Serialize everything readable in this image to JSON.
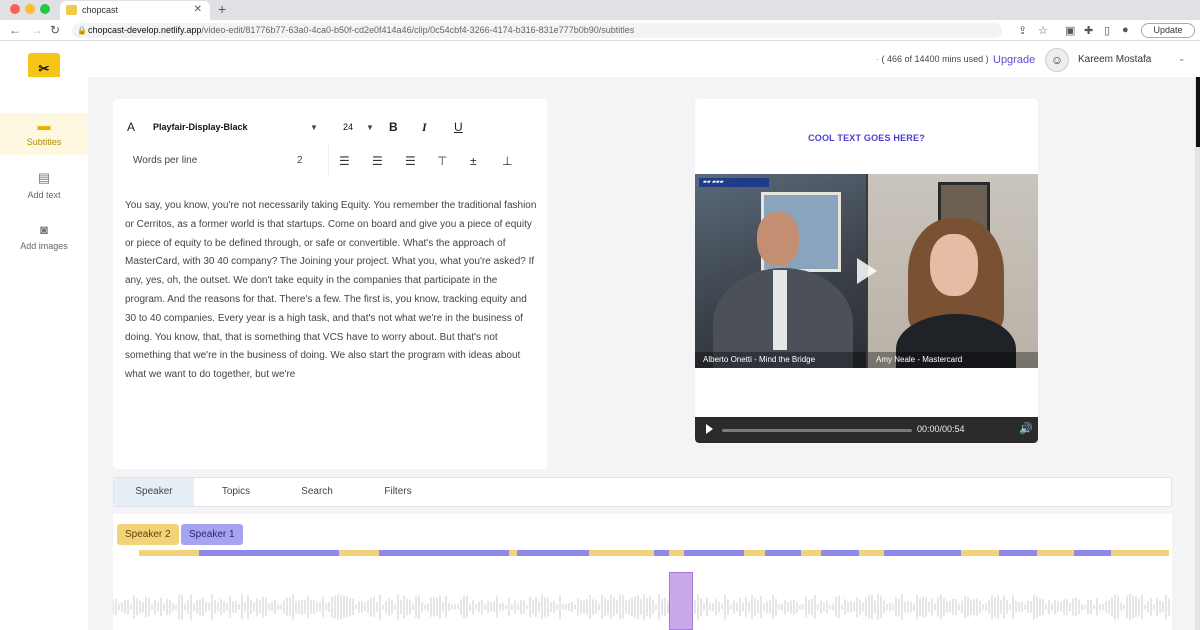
{
  "browser": {
    "tab_title": "chopcast",
    "url_host": "chopcast-develop.netlify.app",
    "url_path": "/video-edit/81776b77-63a0-4ca0-b50f-cd2e0f414a46/clip/0c54cbf4-3266-4174-b316-831e777b0b90/subtitles",
    "update_label": "Update"
  },
  "header": {
    "usage": "( 466 of 14400 mins used )",
    "upgrade_label": "Upgrade",
    "user_name": "Kareem Mostafa"
  },
  "sidebar": {
    "items": [
      {
        "label": "Subtitles",
        "icon": "subtitles-icon"
      },
      {
        "label": "Add text",
        "icon": "text-icon"
      },
      {
        "label": "Add images",
        "icon": "camera-icon"
      }
    ]
  },
  "toolbar": {
    "font_name": "Playfair-Display-Black",
    "font_size": "24",
    "words_per_line_label": "Words per line",
    "words_per_line_value": "2"
  },
  "transcript": "You say, you know, you're not necessarily taking Equity. You remember the traditional fashion or Cerritos, as a former world is that startups. Come on board and give you a piece of equity or piece of equity to be defined through, or safe or convertible. What's the approach of MasterCard, with 30 40 company? The Joining your project. What you, what you're asked? If any, yes, oh, the outset. We don't take equity in the companies that participate in the program. And the reasons for that. There's a few. The first is, you know, tracking equity and 30 to 40 companies. Every year is a high task, and that's not what we're in the business of doing. You know, that, that is something that VCS have to worry about. But that's not something that we're in the business of doing. We also start the program with ideas about what we want to do together, but we're",
  "video": {
    "overlay_text": "COOL TEXT GOES HERE?",
    "speaker_left": "Alberto Onetti - Mind the Bridge",
    "speaker_right": "Amy Neale - Mastercard",
    "time": "00:00/00:54"
  },
  "tabs": [
    "Speaker",
    "Topics",
    "Search",
    "Filters"
  ],
  "speakers": [
    {
      "label": "Speaker 2",
      "color": "#f2d37a"
    },
    {
      "label": "Speaker 1",
      "color": "#a7a3f0"
    }
  ],
  "colors": {
    "accent": "#5a4fcf",
    "speaker_1": "#8e89e8",
    "speaker_2": "#f2d37a"
  }
}
